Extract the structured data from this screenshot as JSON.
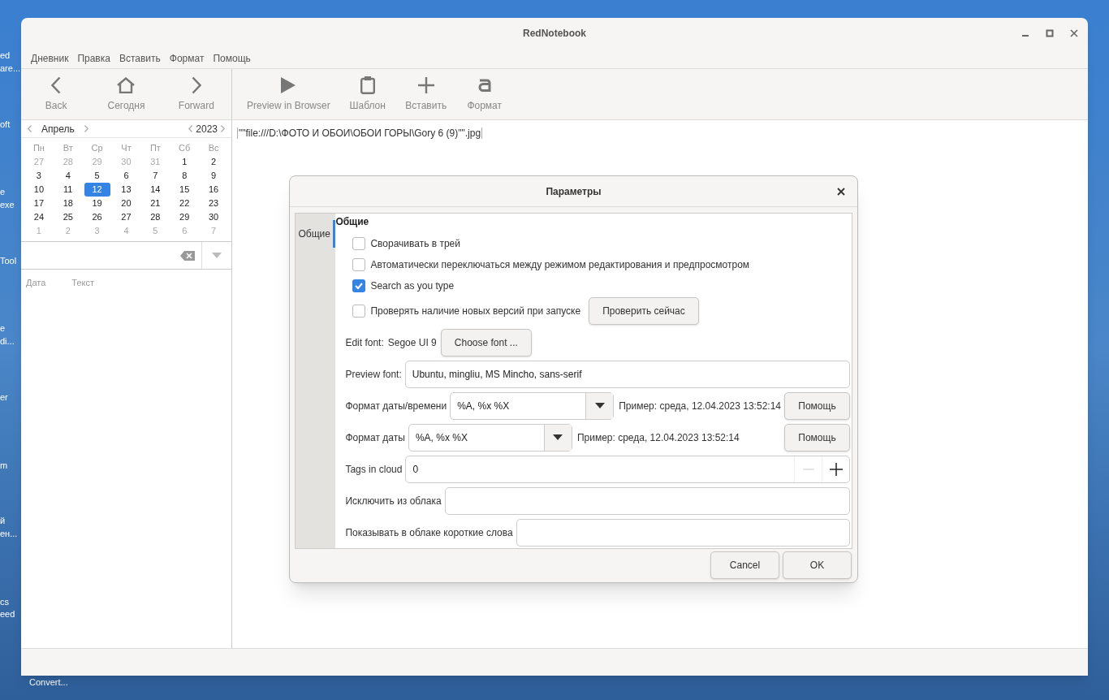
{
  "desktop": {
    "icon_labels": [
      "ed",
      "are...",
      "oft",
      "e",
      "exe",
      "Tool",
      "e",
      "di...",
      "er",
      "m",
      "й",
      "ен...",
      "cs",
      "eed",
      "Convert..."
    ]
  },
  "window": {
    "title": "RedNotebook"
  },
  "menu": [
    "Дневник",
    "Правка",
    "Вставить",
    "Формат",
    "Помощь"
  ],
  "nav_toolbar": [
    "Back",
    "Сегодня",
    "Forward"
  ],
  "editor_toolbar": [
    "Preview in Browser",
    "Шаблон",
    "Вставить",
    "Формат"
  ],
  "calendar": {
    "month": "Апрель",
    "year": "2023",
    "weekdays": [
      "Пн",
      "Вт",
      "Ср",
      "Чт",
      "Пт",
      "Сб",
      "Вс"
    ],
    "days": [
      {
        "d": "27",
        "outside": true,
        "selected": false
      },
      {
        "d": "28",
        "outside": true,
        "selected": false
      },
      {
        "d": "29",
        "outside": true,
        "selected": false
      },
      {
        "d": "30",
        "outside": true,
        "selected": false
      },
      {
        "d": "31",
        "outside": true,
        "selected": false
      },
      {
        "d": "1",
        "outside": false,
        "selected": false
      },
      {
        "d": "2",
        "outside": false,
        "selected": false
      },
      {
        "d": "3",
        "outside": false,
        "selected": false
      },
      {
        "d": "4",
        "outside": false,
        "selected": false
      },
      {
        "d": "5",
        "outside": false,
        "selected": false
      },
      {
        "d": "6",
        "outside": false,
        "selected": false
      },
      {
        "d": "7",
        "outside": false,
        "selected": false
      },
      {
        "d": "8",
        "outside": false,
        "selected": false
      },
      {
        "d": "9",
        "outside": false,
        "selected": false
      },
      {
        "d": "10",
        "outside": false,
        "selected": false
      },
      {
        "d": "11",
        "outside": false,
        "selected": false
      },
      {
        "d": "12",
        "outside": false,
        "selected": true
      },
      {
        "d": "13",
        "outside": false,
        "selected": false
      },
      {
        "d": "14",
        "outside": false,
        "selected": false
      },
      {
        "d": "15",
        "outside": false,
        "selected": false
      },
      {
        "d": "16",
        "outside": false,
        "selected": false
      },
      {
        "d": "17",
        "outside": false,
        "selected": false
      },
      {
        "d": "18",
        "outside": false,
        "selected": false
      },
      {
        "d": "19",
        "outside": false,
        "selected": false
      },
      {
        "d": "20",
        "outside": false,
        "selected": false
      },
      {
        "d": "21",
        "outside": false,
        "selected": false
      },
      {
        "d": "22",
        "outside": false,
        "selected": false
      },
      {
        "d": "23",
        "outside": false,
        "selected": false
      },
      {
        "d": "24",
        "outside": false,
        "selected": false
      },
      {
        "d": "25",
        "outside": false,
        "selected": false
      },
      {
        "d": "26",
        "outside": false,
        "selected": false
      },
      {
        "d": "27",
        "outside": false,
        "selected": false
      },
      {
        "d": "28",
        "outside": false,
        "selected": false
      },
      {
        "d": "29",
        "outside": false,
        "selected": false
      },
      {
        "d": "30",
        "outside": false,
        "selected": false
      },
      {
        "d": "1",
        "outside": true,
        "selected": false
      },
      {
        "d": "2",
        "outside": true,
        "selected": false
      },
      {
        "d": "3",
        "outside": true,
        "selected": false
      },
      {
        "d": "4",
        "outside": true,
        "selected": false
      },
      {
        "d": "5",
        "outside": true,
        "selected": false
      },
      {
        "d": "6",
        "outside": true,
        "selected": false
      },
      {
        "d": "7",
        "outside": true,
        "selected": false
      }
    ]
  },
  "search_columns": [
    "Дата",
    "Текст"
  ],
  "editor_text": "\"\"file:///D:\\ФОТО И ОБОИ\\ОБОИ ГОРЫ\\Gory 6 (9)\"\".jpg",
  "dialog": {
    "title": "Параметры",
    "tabs": [
      {
        "label": "Общие",
        "selected": true
      }
    ],
    "section": "Общие",
    "rows": [
      {
        "kind": "checkbox",
        "label": "Сворачивать в трей",
        "checked": false
      },
      {
        "kind": "checkbox",
        "label": "Автоматически переключаться между режимом редактирования и предпросмотром",
        "checked": false
      },
      {
        "kind": "checkbox",
        "label": "Search as you type",
        "checked": true
      },
      {
        "kind": "checkbox",
        "label": "Проверять наличие новых версий при запуске",
        "checked": false,
        "button": "Проверить сейчас"
      },
      {
        "kind": "font",
        "label": "Edit font:",
        "value": "Segoe UI 9",
        "button": "Choose font ..."
      },
      {
        "kind": "field",
        "label": "Preview font:",
        "value": "Ubuntu, mingliu, MS Mincho, sans-serif"
      },
      {
        "kind": "combo",
        "label": "Формат даты/времени",
        "value": "%A, %x %X",
        "example": "Пример: среда, 12.04.2023 13:52:14",
        "button": "Помощь"
      },
      {
        "kind": "combo",
        "label": "Формат даты",
        "value": "%A, %x %X",
        "example": "Пример: среда, 12.04.2023 13:52:14",
        "button": "Помощь"
      },
      {
        "kind": "spin",
        "label": "Tags in cloud",
        "value": "0"
      },
      {
        "kind": "field",
        "label": "Исключить из облака"
      },
      {
        "kind": "field",
        "label": "Показывать в облаке короткие слова"
      }
    ],
    "buttons": [
      "Cancel",
      "OK"
    ]
  }
}
